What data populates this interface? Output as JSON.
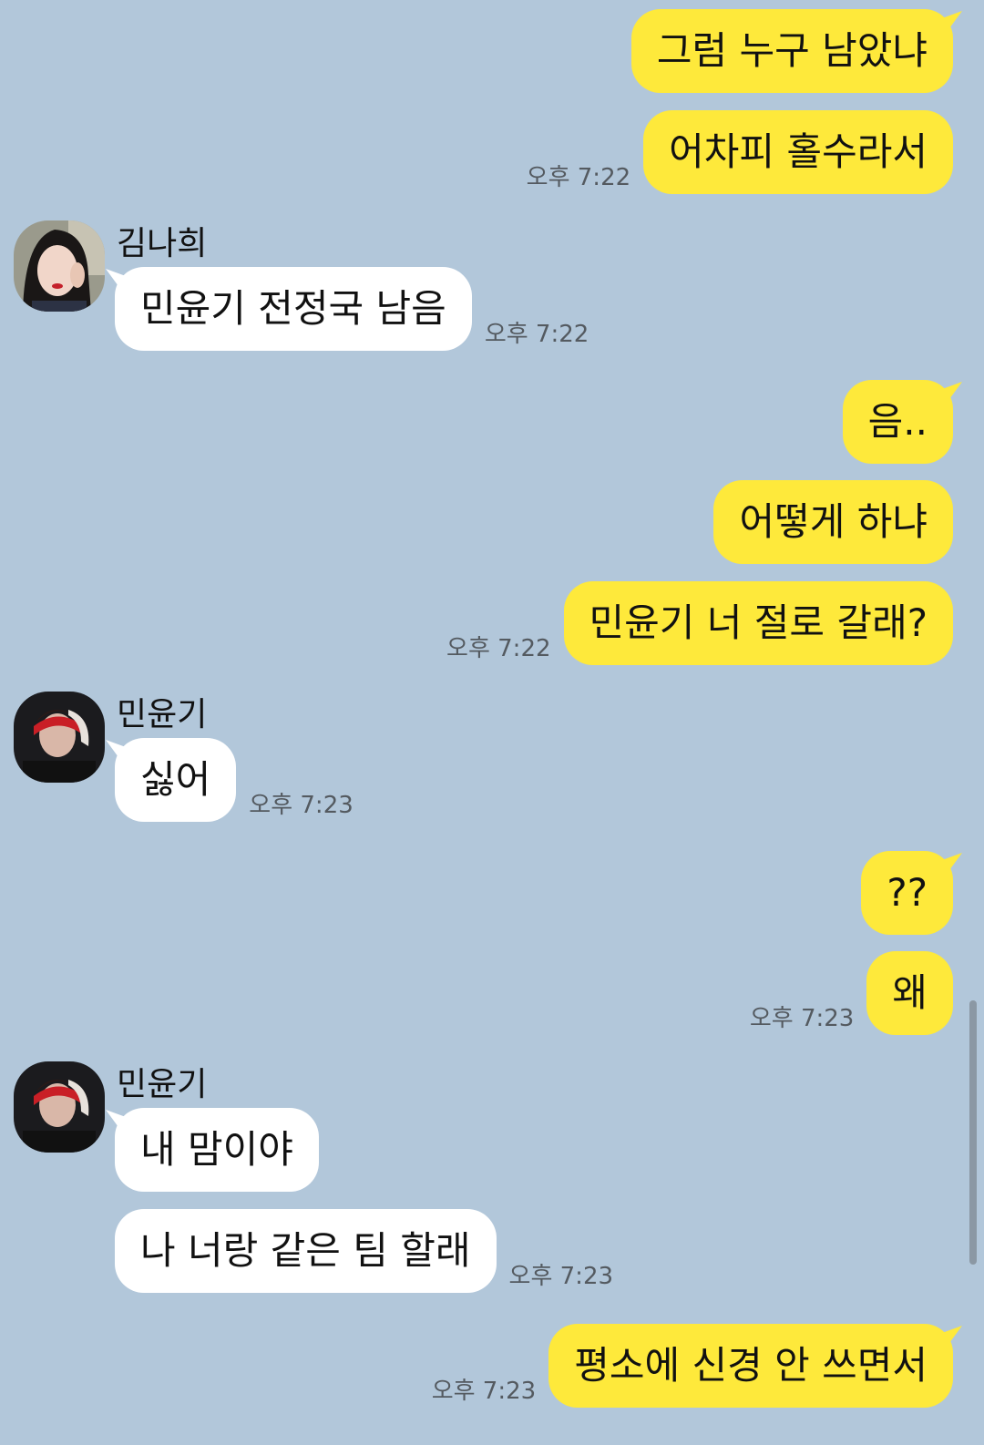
{
  "colors": {
    "background": "#b2c7da",
    "my_bubble": "#fee93b",
    "other_bubble": "#ffffff",
    "time_text": "#545a60"
  },
  "messages": [
    {
      "sender": "me",
      "text": "그럼 누구 남았냐"
    },
    {
      "sender": "me",
      "text": "어차피 홀수라서",
      "time": "오후 7:22"
    },
    {
      "sender": "김나희",
      "text": "민윤기 전정국 남음",
      "time": "오후 7:22"
    },
    {
      "sender": "me",
      "text": "음.."
    },
    {
      "sender": "me",
      "text": "어떻게 하냐"
    },
    {
      "sender": "me",
      "text": "민윤기 너 절로 갈래?",
      "time": "오후 7:22"
    },
    {
      "sender": "민윤기",
      "text": "싫어",
      "time": "오후 7:23"
    },
    {
      "sender": "me",
      "text": "??"
    },
    {
      "sender": "me",
      "text": "왜",
      "time": "오후 7:23"
    },
    {
      "sender": "민윤기",
      "text": "내 맘이야"
    },
    {
      "sender": "민윤기",
      "text": "나 너랑 같은 팀 할래",
      "time": "오후 7:23"
    },
    {
      "sender": "me",
      "text": "평소에 신경 안 쓰면서",
      "time": "오후 7:23"
    }
  ],
  "senders": {
    "naheui": {
      "name": "김나희",
      "avatar_icon": "profile-photo-woman"
    },
    "yoongi": {
      "name": "민윤기",
      "avatar_icon": "profile-photo-man-red-headband"
    }
  }
}
